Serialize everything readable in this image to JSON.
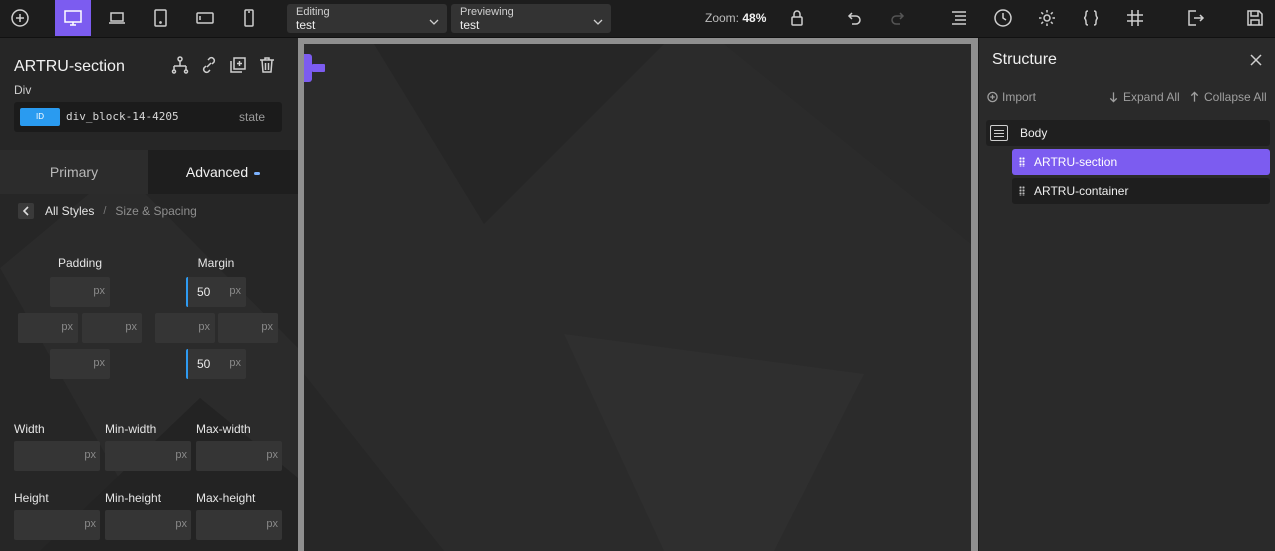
{
  "toolbar": {
    "add_icon": "plus-circle-icon",
    "device_icons": [
      "desktop-icon",
      "laptop-icon",
      "tablet-icon",
      "tablet-landscape-icon",
      "mobile-icon"
    ],
    "editing_label": "Editing",
    "editing_value": "test",
    "previewing_label": "Previewing",
    "previewing_value": "test",
    "zoom_label": "Zoom:",
    "zoom_value": "48%",
    "right_icons": [
      "lock-icon",
      "undo-icon",
      "redo-icon",
      "structure-icon",
      "history-icon",
      "settings-icon",
      "code-braces-icon",
      "grid-hash-icon",
      "exit-icon",
      "save-icon"
    ],
    "accent": "#7c5cf0"
  },
  "left_panel": {
    "element_title": "ARTRU-section",
    "element_type": "Div",
    "action_icons": [
      "structure-tree-icon",
      "link-icon",
      "duplicate-icon",
      "trash-icon"
    ],
    "id_badge": "ID",
    "id_value": "div_block-14-4205",
    "state_label": "state",
    "tabs": {
      "primary": "Primary",
      "advanced": "Advanced"
    },
    "breadcrumb": {
      "root": "All Styles",
      "separator": "/",
      "current": "Size & Spacing"
    },
    "spacing": {
      "padding_label": "Padding",
      "margin_label": "Margin",
      "unit": "px",
      "padding": {
        "top": "",
        "left": "",
        "right": "",
        "bottom": ""
      },
      "margin": {
        "top": "50",
        "left": "",
        "right": "",
        "bottom": "50"
      }
    },
    "dimensions": {
      "width_label": "Width",
      "min_width_label": "Min-width",
      "max_width_label": "Max-width",
      "height_label": "Height",
      "min_height_label": "Min-height",
      "max_height_label": "Max-height",
      "unit": "px"
    }
  },
  "structure": {
    "title": "Structure",
    "import_label": "Import",
    "expand_all": "Expand All",
    "collapse_all": "Collapse All",
    "body_label": "Body",
    "items": [
      {
        "label": "ARTRU-section",
        "selected": true
      },
      {
        "label": "ARTRU-container",
        "selected": false
      }
    ]
  }
}
